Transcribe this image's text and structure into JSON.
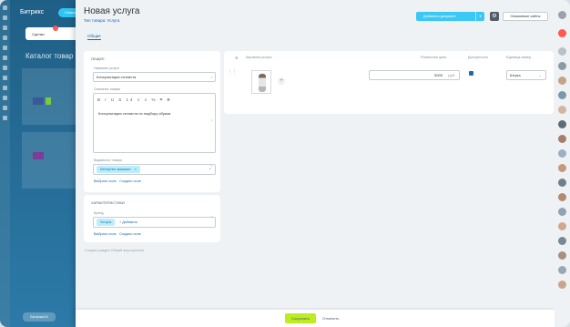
{
  "app": {
    "brand": "Битрикс",
    "header_button": "Новая",
    "bottom_button": "Битрикс24"
  },
  "under": {
    "tab_label": "Сделки",
    "catalog_title": "Каталог товар"
  },
  "panel": {
    "title": "Новая услуга",
    "subtitle": "Тип товара: Услуга",
    "tab": "Общие",
    "create_doc_button": "Добавить документ",
    "links_button": "Связанные сайты"
  },
  "main_card": {
    "heading": "Общее",
    "name_label": "Название услуги",
    "name_value": "Консультация стилиста",
    "description_label": "Описание товара",
    "toolbar": "B  I  U  S  14  ≡  ≡  %  ⌗  ⊕",
    "description_text": "Консультация стилиста по подбору образа",
    "visibility_label": "Видимость товара",
    "visibility_chip": "Интернет-магазин",
    "select_field": "Выбрать поле",
    "create_field": "Создать поле"
  },
  "char_card": {
    "heading": "Характеристики",
    "brand_label": "Бренд",
    "brand_chip": "Услуга",
    "add_label": "+ Добавить",
    "select_field": "Выбрать поле",
    "create_field": "Создать поле"
  },
  "bottom_links": "Создать раздел    Общий вид карточки",
  "table": {
    "headers": [
      "Картинки услуги",
      "Розничная цена",
      "Доступность",
      "Единица измер."
    ],
    "price": "5000",
    "currency": "руб.",
    "unit": "Штука"
  },
  "footer": {
    "save": "Сохранить",
    "cancel": "Отменить"
  }
}
